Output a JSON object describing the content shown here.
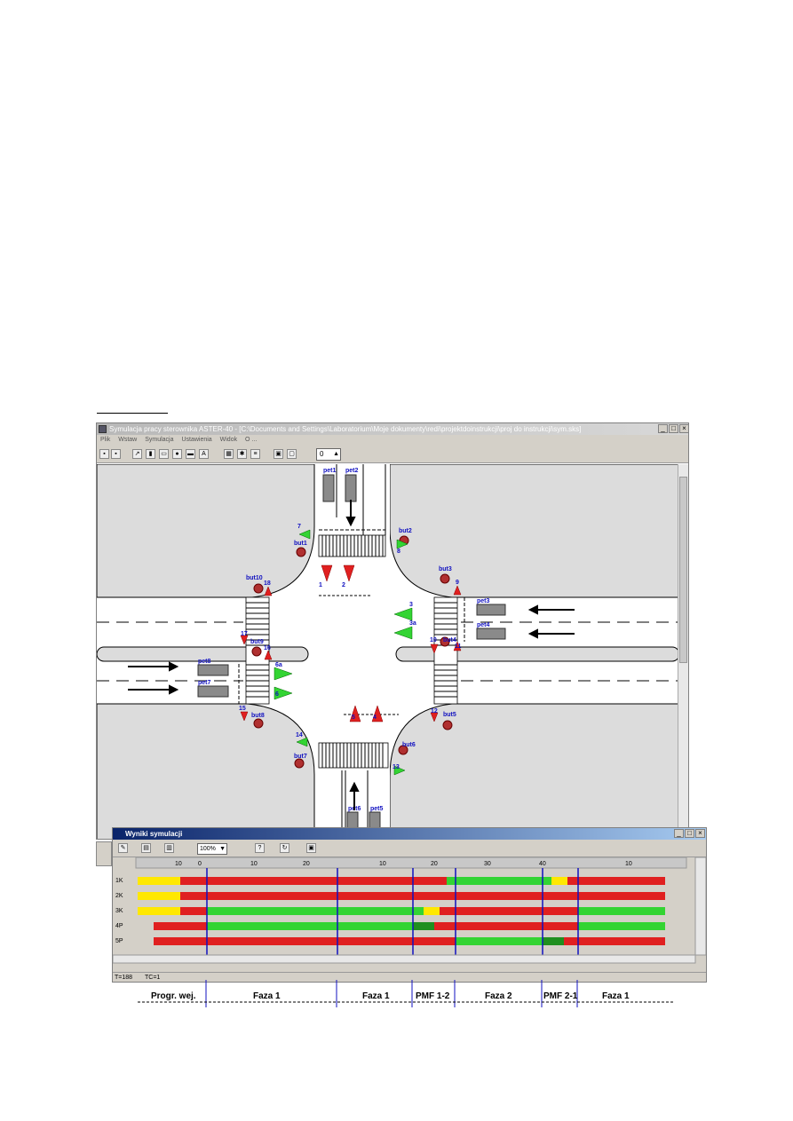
{
  "sim_window": {
    "title": "Symulacja pracy sterownika ASTER-40 - [C:\\Documents and Settings\\Laboratorium\\Moje dokumenty\\redi\\projektdoinstrukcji\\proj do instrukcji\\sym.sks]",
    "menu": [
      "Plik",
      "Wstaw",
      "Symulacja",
      "Ustawienia",
      "Widok",
      "O ..."
    ],
    "toolbar_counter": "0"
  },
  "intersection": {
    "detectors": [
      "pet1",
      "pet2",
      "pet3",
      "pet4",
      "pet5",
      "pet6",
      "pet7",
      "pet8"
    ],
    "buttons": [
      "but1",
      "but2",
      "but3",
      "but4",
      "but5",
      "but6",
      "but7",
      "but8",
      "but9",
      "but10"
    ],
    "signals": [
      "1",
      "2",
      "3",
      "3a",
      "4",
      "5",
      "6",
      "6a",
      "7",
      "8",
      "9",
      "10",
      "11",
      "12",
      "13",
      "14",
      "15",
      "16",
      "17",
      "18"
    ]
  },
  "results_window": {
    "title": "Wyniki symulacji",
    "zoom": "100%",
    "ruler_labels": [
      "10",
      "0",
      "10",
      "20",
      "10",
      "20",
      "30",
      "40",
      "10"
    ],
    "rows": [
      "1K",
      "2K",
      "3K",
      "4P",
      "5P"
    ],
    "status": [
      "T=188",
      "TC=1"
    ]
  },
  "phases": [
    {
      "label": "Progr. wej."
    },
    {
      "label": "Faza 1"
    },
    {
      "label": "Faza 1"
    },
    {
      "label": "PMF 1-2"
    },
    {
      "label": "Faza 2"
    },
    {
      "label": "PMF 2-1"
    },
    {
      "label": "Faza 1"
    }
  ],
  "colors": {
    "red": "#e02020",
    "green": "#33d433",
    "yellow": "#ffe800",
    "blue_label": "#1010c0",
    "road": "#dcdcdc"
  }
}
